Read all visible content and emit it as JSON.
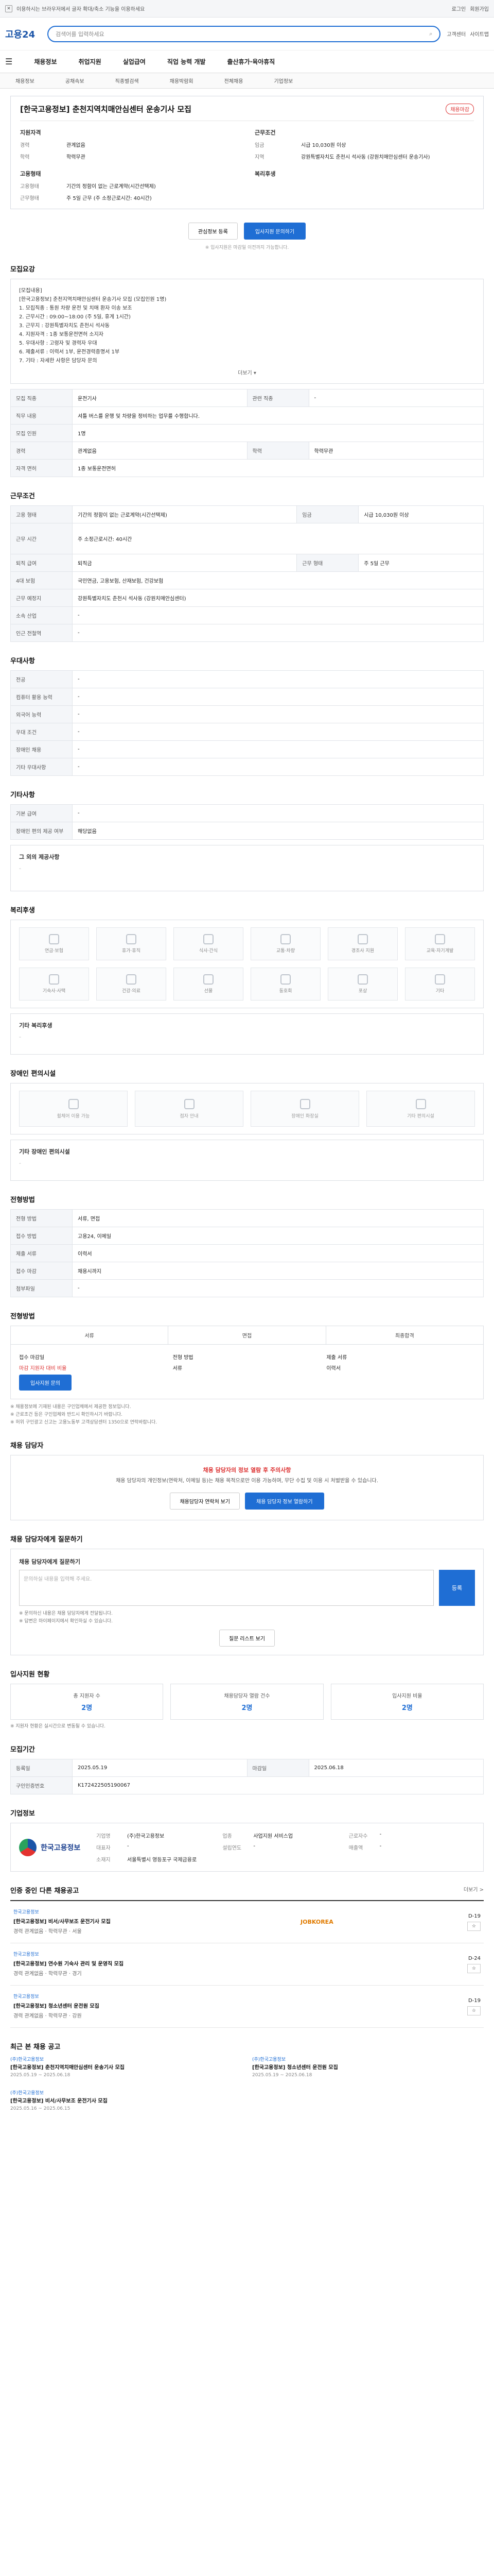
{
  "topbar": {
    "notice": "이용하시는 브라우저에서 글자 확대/축소 기능을 이용하세요",
    "links": [
      "로그인",
      "회원가입"
    ]
  },
  "header": {
    "logo": "고용24",
    "search_placeholder": "검색어를 입력하세요",
    "right_links": [
      "고객센터",
      "사이트맵"
    ]
  },
  "gnb": [
    "채용정보",
    "취업지원",
    "실업급여",
    "직업 능력 개발",
    "출산휴가·육아휴직"
  ],
  "subnav": [
    "채용정보",
    "공채속보",
    "직종별검색",
    "채용박람회",
    "전체채용",
    "기업정보"
  ],
  "summary": {
    "title": "[한국고용정보] 춘천지역치매안심센터 운송기사 모집",
    "badge": "채용마감",
    "left_title": "지원자격",
    "left": [
      [
        "경력",
        "관계없음"
      ],
      [
        "학력",
        "학력무관"
      ]
    ],
    "right_title": "근무조건",
    "right": [
      [
        "임금",
        "시급 10,030원 이상"
      ],
      [
        "지역",
        "강원특별자치도 춘천시 석사동 (강원치매안심센터 운송기사)"
      ]
    ],
    "left2_title": "고용형태",
    "left2": [
      [
        "고용형태",
        "기간의 정함이 없는 근로계약(시간선택제)"
      ],
      [
        "근무형태",
        "주 5일 근무 (주 소정근로시간: 40시간)"
      ]
    ],
    "right2_title": "복리후생",
    "save_btn": "관심정보 등록",
    "apply_btn": "입사지원 문의하기",
    "small_note": "※ 입사지원은 마감일 이전까지 가능합니다."
  },
  "section_recruit": {
    "title": "모집요강",
    "lines": [
      "[모집내용]",
      "[한국고용정보] 춘천지역치매안심센터 운송기사 모집 (모집인원 1명)",
      "1. 모집직종 : 통원 차량 운전 및 치매 환자 이송 보조",
      "2. 근무시간 : 09:00~18:00 (주 5일, 휴게 1시간)",
      "3. 근무지 : 강원특별자치도 춘천시 석사동",
      "4. 지원자격 : 1종 보통운전면허 소지자",
      "5. 우대사항 : 고령자 및 경력자 우대",
      "6. 제출서류 : 이력서 1부, 운전경력증명서 1부",
      "7. 기타 : 자세한 사항은 담당자 문의"
    ],
    "more": "더보기 ▾",
    "rows": [
      [
        "모집 직종",
        "운전기사",
        "관련 직종",
        "-"
      ],
      [
        "직무 내용",
        "셔틀 버스를 운행 및 차량을 정비하는 업무를 수행합니다.",
        "",
        ""
      ],
      [
        "모집 인원",
        "1명",
        "",
        ""
      ],
      [
        "경력",
        "관계없음",
        "학력",
        "학력무관"
      ],
      [
        "자격 면허",
        "1종 보통운전면허",
        "",
        ""
      ]
    ]
  },
  "section_work": {
    "title": "근무조건",
    "rows": [
      [
        "고용 형태",
        "기간의 정함이 없는 근로계약(시간선택제)",
        "임금",
        "시급 10,030원 이상"
      ],
      [
        "근무 시간",
        "주 소정근로시간: 40시간",
        "",
        ""
      ],
      [
        "퇴직 급여",
        "퇴직금",
        "근무 형태",
        "주 5일 근무"
      ],
      [
        "4대 보험",
        "국민연금, 고용보험, 산재보험, 건강보험",
        "",
        ""
      ],
      [
        "근무 예정지",
        "강원특별자치도 춘천시 석사동 (강원치매안심센터)",
        "",
        ""
      ],
      [
        "소속 산업",
        "-",
        "",
        ""
      ],
      [
        "인근 전철역",
        "-",
        "",
        ""
      ]
    ]
  },
  "section_prefer": {
    "title": "우대사항",
    "rows": [
      [
        "전공",
        "-"
      ],
      [
        "컴퓨터 활용 능력",
        "-"
      ],
      [
        "외국어 능력",
        "-"
      ],
      [
        "우대 조건",
        "-"
      ],
      [
        "장애인 채용",
        "-"
      ],
      [
        "기타 우대사항",
        "-"
      ]
    ]
  },
  "section_extra": {
    "title": "기타사항",
    "rows": [
      [
        "기본 급여",
        "-"
      ],
      [
        "장애인 편의 제공 여부",
        "해당없음"
      ]
    ],
    "note_title": "그 외의 제공사항",
    "note": "-"
  },
  "section_welfare": {
    "title": "복리후생",
    "cards": [
      "연금·보험",
      "휴가·휴직",
      "식사·간식",
      "교통·차량",
      "경조사 지원",
      "교육·자기계발",
      "기숙사·사택",
      "건강·의료",
      "선물",
      "동호회",
      "포상",
      "기타"
    ],
    "etc_title": "기타 복리후생",
    "etc": "-"
  },
  "section_disability": {
    "title": "장애인 편의시설",
    "cards": [
      "휠체어 이용 가능",
      "점자 안내",
      "장애인 화장실",
      "기타 편의시설"
    ],
    "etc_title": "기타 장애인 편의시설",
    "etc": "-"
  },
  "section_process": {
    "title": "전형방법",
    "rows": [
      [
        "전형 방법",
        "서류, 면접"
      ],
      [
        "접수 방법",
        "고용24, 이메일"
      ],
      [
        "제출 서류",
        "이력서"
      ],
      [
        "접수 마감",
        "채용시까지"
      ],
      [
        "첨부파일",
        "-"
      ]
    ]
  },
  "section_apply": {
    "title": "전형방법",
    "steps": [
      "서류",
      "면접",
      "최종합격"
    ],
    "col1": [
      "접수 마감일",
      "마감 지원자 대비 비율",
      "입사지원 문의"
    ],
    "col2": [
      "전형 방법",
      "서류"
    ],
    "col3": [
      "제출 서류",
      "이력서"
    ],
    "notes": [
      "※ 채용정보에 기재된 내용은 구인업체에서 제공한 정보입니다.",
      "※ 근로조건 등은 구인업체와 반드시 확인하시기 바랍니다.",
      "※ 허위 구인광고 신고는 고용노동부 고객상담센터 1350으로 연락바랍니다."
    ]
  },
  "section_contact": {
    "title": "채용 담당자",
    "t1": "채용 담당자의 정보 열람 후 주의사항",
    "t2": "채용 담당자의 개인정보(연락처, 이메일 등)는 채용 목적으로만 이용 가능하며, 무단 수집 및 이용 시 처벌받을 수 있습니다.",
    "btn1": "채용담당자 연락처 보기",
    "btn2": "채용 담당자 정보 열람하기"
  },
  "section_inquiry": {
    "title": "채용 담당자에게 질문하기",
    "label": "채용 담당자에게 질문하기",
    "placeholder": "문의하실 내용을 입력해 주세요.",
    "send": "등록",
    "notes": [
      "※ 문의하신 내용은 채용 담당자에게 전달됩니다.",
      "※ 답변은 마이페이지에서 확인하실 수 있습니다."
    ],
    "more": "질문 리스트 보기"
  },
  "section_stats": {
    "title": "입사지원 현황",
    "cards": [
      {
        "label": "총 지원자 수",
        "num": "2명"
      },
      {
        "label": "채용담당자 열람 건수",
        "num": "2명"
      },
      {
        "label": "입사지원 비율",
        "num": "2명"
      }
    ],
    "note": "※ 지원자 현황은 실시간으로 변동될 수 있습니다."
  },
  "section_company_info": {
    "title": "모집기간",
    "rows": [
      [
        "등록일",
        "2025.05.19",
        "마감일",
        "2025.06.18"
      ],
      [
        "구인인증번호",
        "K172422505190067",
        "",
        ""
      ]
    ]
  },
  "section_company": {
    "title": "기업정보",
    "logo": "한국고용정보",
    "rows": [
      [
        "기업명",
        "(주)한국고용정보",
        "업종",
        "사업지원 서비스업",
        "근로자수",
        "-"
      ],
      [
        "대표자",
        "-",
        "설립연도",
        "-",
        "매출액",
        "-"
      ],
      [
        "소재지",
        "서울특별시 영등포구 국제금융로",
        "",
        "",
        "",
        ""
      ]
    ]
  },
  "section_jobs": {
    "title": "인증 중인 다른 채용공고",
    "more": "더보기 >",
    "items": [
      {
        "company": "한국고용정보",
        "title": "[한국고용정보] 비서/사무보조 운전기사 모집",
        "meta": "경력 관계없음 · 학력무관 · 서울",
        "badge": "JOBKOREA",
        "date": "D-19"
      },
      {
        "company": "한국고용정보",
        "title": "[한국고용정보] 연수원 기숙사 관리 및 운영직 모집",
        "meta": "경력 관계없음 · 학력무관 · 경기",
        "badge": "",
        "date": "D-24"
      },
      {
        "company": "한국고용정보",
        "title": "[한국고용정보] 청소년센터 운전원 모집",
        "meta": "경력 관계없음 · 학력무관 · 강원",
        "badge": "",
        "date": "D-19"
      }
    ]
  },
  "section_recent": {
    "title": "최근 본 채용 공고",
    "items": [
      {
        "org": "(주)한국고용정보",
        "title": "[한국고용정보] 춘천지역치매안심센터 운송기사 모집",
        "date": "2025.05.19 ~ 2025.06.18"
      },
      {
        "org": "(주)한국고용정보",
        "title": "[한국고용정보] 청소년센터 운전원 모집",
        "date": "2025.05.19 ~ 2025.06.18"
      },
      {
        "org": "(주)한국고용정보",
        "title": "[한국고용정보] 비서/사무보조 운전기사 모집",
        "date": "2025.05.16 ~ 2025.06.15"
      }
    ]
  }
}
